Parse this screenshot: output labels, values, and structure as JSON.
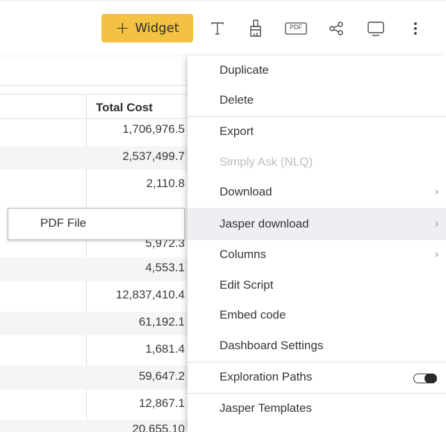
{
  "toolbar": {
    "widget_button": "+ Widget",
    "widget_plus": "+",
    "widget_label": "Widget",
    "icons": [
      "text-icon",
      "paint-brush-icon",
      "pdf-icon",
      "share-icon",
      "monitor-icon",
      "more-vertical-icon"
    ],
    "pdf_label": "PDF",
    "accent_color": "#f4c242"
  },
  "table": {
    "column_header": "Total Cost",
    "rows": [
      "1,706,976.5",
      "2,537,499.7",
      "2,110.8",
      "",
      "5,972.3",
      "4,553.1",
      "12,837,410.4",
      "61,192.1",
      "1,681.4",
      "59,647.2",
      "12,867.1",
      "20,655.10"
    ]
  },
  "submenu": {
    "items": [
      "PDF File"
    ]
  },
  "menu": {
    "items": [
      {
        "label": "Duplicate"
      },
      {
        "label": "Delete"
      },
      {
        "label": "Export"
      },
      {
        "label": "Simply Ask (NLQ)",
        "disabled": true
      },
      {
        "label": "Download",
        "submenu": true
      },
      {
        "label": "Jasper download",
        "submenu": true,
        "highlighted": true
      },
      {
        "label": "Columns",
        "submenu": true
      },
      {
        "label": "Edit Script"
      },
      {
        "label": "Embed code"
      },
      {
        "label": "Dashboard Settings"
      },
      {
        "label": "Exploration Paths",
        "toggle": true,
        "toggle_on": true
      },
      {
        "label": "Jasper Templates"
      }
    ]
  }
}
